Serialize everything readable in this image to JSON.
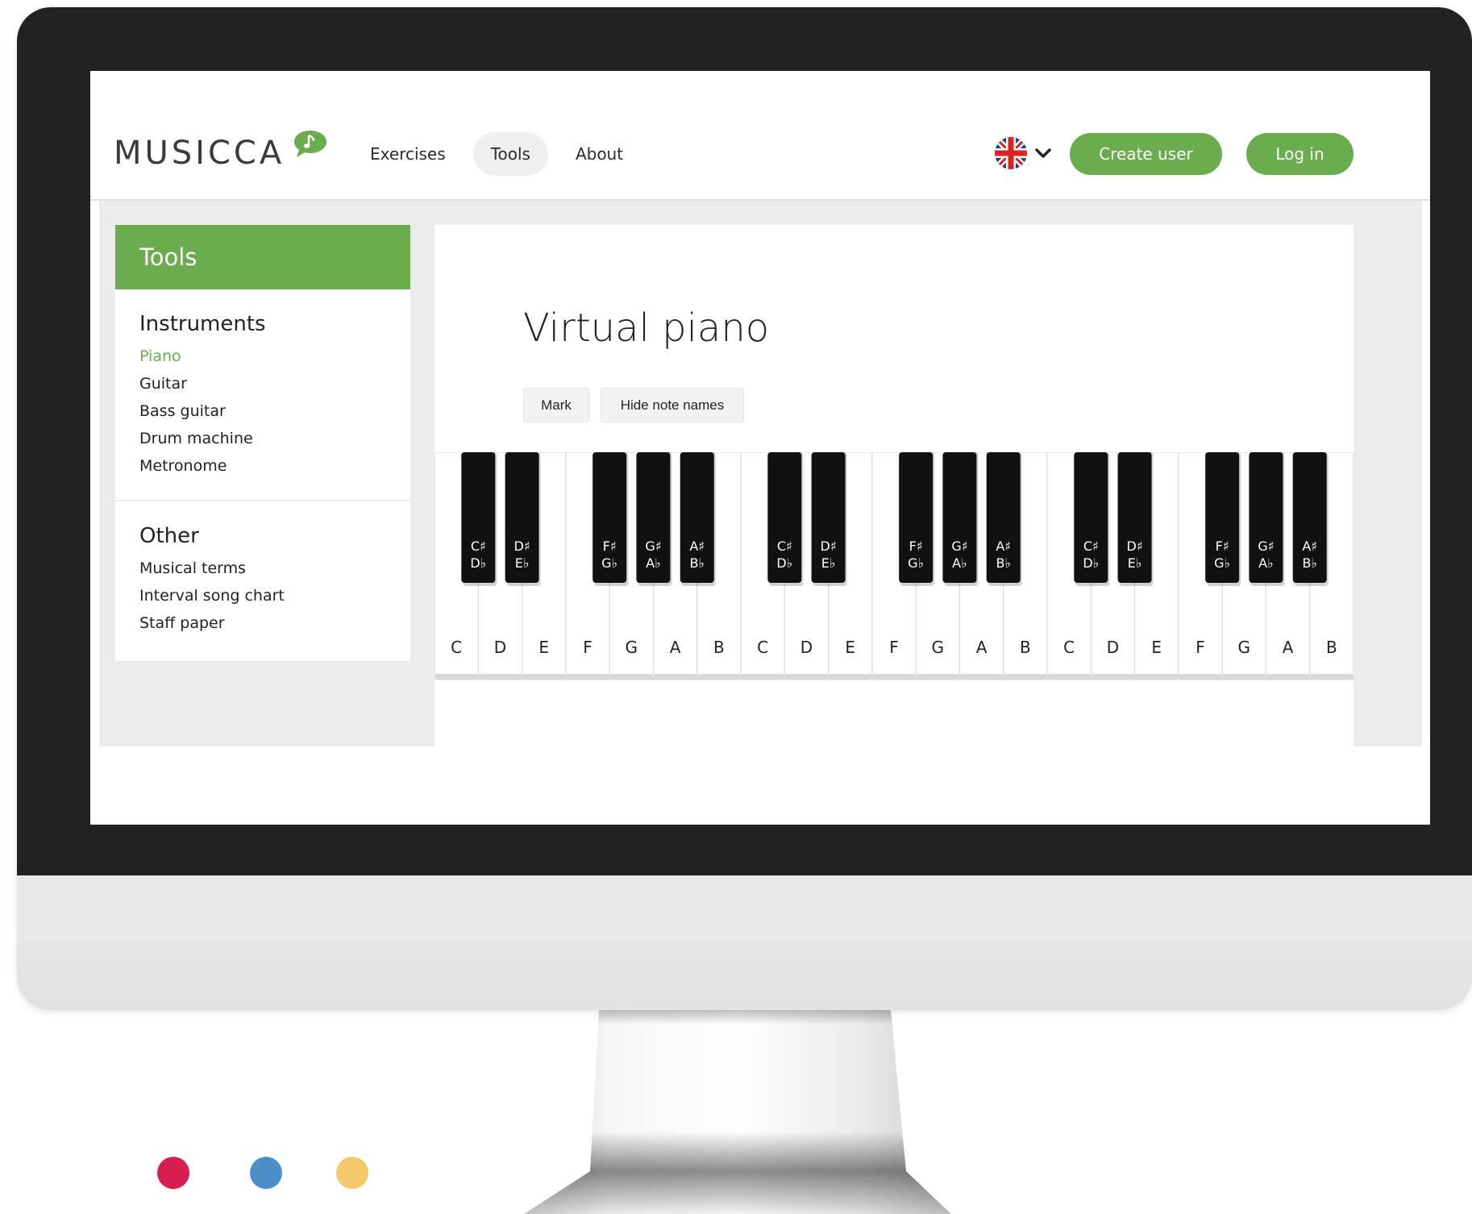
{
  "header": {
    "logo_text": "MUSICCA",
    "nav": [
      {
        "label": "Exercises",
        "active": false
      },
      {
        "label": "Tools",
        "active": true
      },
      {
        "label": "About",
        "active": false
      }
    ],
    "language_icon": "uk-flag-icon",
    "create_user_label": "Create user",
    "login_label": "Log in"
  },
  "sidebar": {
    "title": "Tools",
    "groups": [
      {
        "title": "Instruments",
        "items": [
          {
            "label": "Piano",
            "active": true
          },
          {
            "label": "Guitar",
            "active": false
          },
          {
            "label": "Bass guitar",
            "active": false
          },
          {
            "label": "Drum machine",
            "active": false
          },
          {
            "label": "Metronome",
            "active": false
          }
        ]
      },
      {
        "title": "Other",
        "items": [
          {
            "label": "Musical terms",
            "active": false
          },
          {
            "label": "Interval song chart",
            "active": false
          },
          {
            "label": "Staff paper",
            "active": false
          }
        ]
      }
    ]
  },
  "main": {
    "title": "Virtual piano",
    "buttons": {
      "mark": "Mark",
      "hide_note_names": "Hide note names"
    }
  },
  "piano": {
    "octaves": 3,
    "white_keys": [
      "C",
      "D",
      "E",
      "F",
      "G",
      "A",
      "B"
    ],
    "black_keys": [
      {
        "after": 0,
        "sharp": "C♯",
        "flat": "D♭"
      },
      {
        "after": 1,
        "sharp": "D♯",
        "flat": "E♭"
      },
      {
        "after": 3,
        "sharp": "F♯",
        "flat": "G♭"
      },
      {
        "after": 4,
        "sharp": "G♯",
        "flat": "A♭"
      },
      {
        "after": 5,
        "sharp": "A♯",
        "flat": "B♭"
      }
    ]
  },
  "colors": {
    "brand_green": "#6aac4e",
    "bezel": "#222222",
    "decor_dots": [
      "#d81e4f",
      "#4a8fc8",
      "#f4c96a"
    ]
  }
}
